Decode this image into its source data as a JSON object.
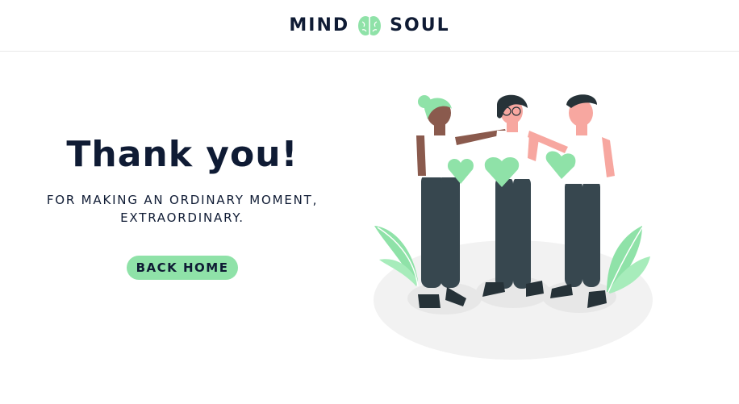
{
  "header": {
    "brand_left": "MIND",
    "brand_right": "SOUL",
    "logo_icon": "brain-icon"
  },
  "main": {
    "title": "Thank you!",
    "subtitle_line1": "FOR MAKING AN ORDINARY MOMENT,",
    "subtitle_line2": "EXTRAORDINARY.",
    "back_button_label": "BACK HOME"
  },
  "colors": {
    "accent": "#8fe2a8",
    "text": "#0f1b34",
    "skin_light": "#f7a7a0",
    "skin_dark": "#8a5a4d",
    "pants": "#37474f"
  }
}
